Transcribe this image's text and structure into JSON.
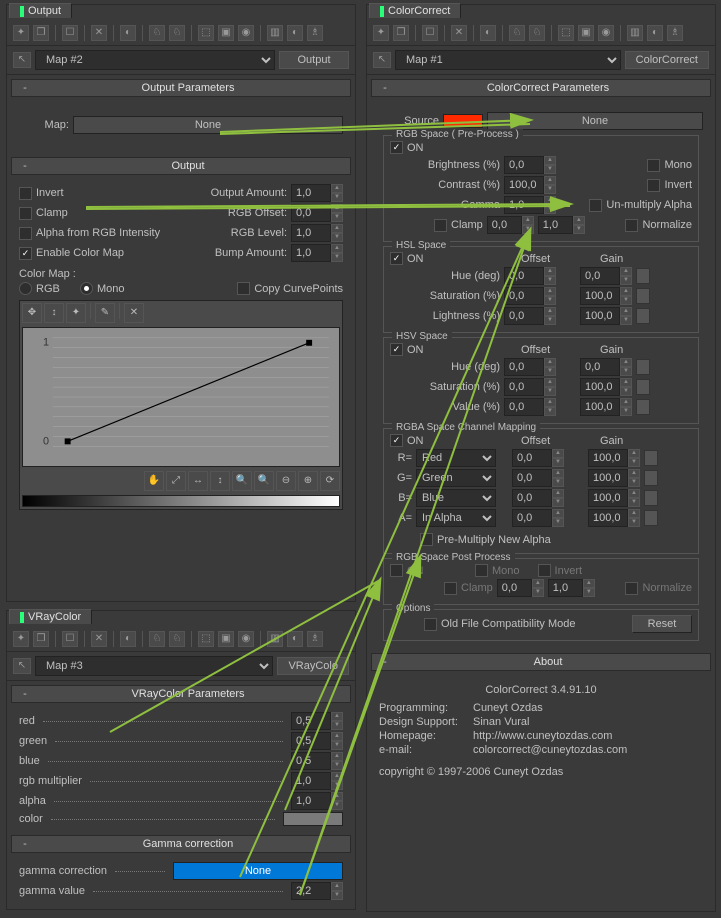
{
  "output_panel": {
    "tab_title": "Output",
    "map_select": "Map #2",
    "map_button": "Output",
    "params_section": "Output Parameters",
    "map_label": "Map:",
    "map_slot": "None",
    "output_section": "Output",
    "invert": "Invert",
    "clamp": "Clamp",
    "alpha_from_rgb": "Alpha from RGB Intensity",
    "enable_color_map": "Enable Color Map",
    "output_amount": "Output Amount:",
    "output_amount_val": "1,0",
    "rgb_offset": "RGB Offset:",
    "rgb_offset_val": "0,0",
    "rgb_level": "RGB Level:",
    "rgb_level_val": "1,0",
    "bump_amount": "Bump Amount:",
    "bump_amount_val": "1,0",
    "color_map": "Color Map :",
    "rgb_radio": "RGB",
    "mono_radio": "Mono",
    "copy_curvepoints": "Copy CurvePoints"
  },
  "vray_panel": {
    "tab_title": "VRayColor",
    "map_select": "Map #3",
    "map_button": "VRayColo",
    "params_section": "VRayColor Parameters",
    "red": "red",
    "red_val": "0,5",
    "green": "green",
    "green_val": "0,5",
    "blue": "blue",
    "blue_val": "0,5",
    "rgb_mult": "rgb multiplier",
    "rgb_mult_val": "1,0",
    "alpha": "alpha",
    "alpha_val": "1,0",
    "color": "color",
    "gamma_section": "Gamma correction",
    "gamma_corr": "gamma correction",
    "gamma_corr_val": "None",
    "gamma_value": "gamma value",
    "gamma_value_val": "2,2"
  },
  "cc_panel": {
    "tab_title": "ColorCorrect",
    "map_select": "Map #1",
    "map_button": "ColorCorrect",
    "params_section": "ColorCorrect Parameters",
    "source": "Source",
    "source_slot": "None",
    "rgb_space_pre": "RGB Space ( Pre-Process )",
    "on": "ON",
    "brightness": "Brightness (%)",
    "brightness_val": "0,0",
    "contrast": "Contrast (%)",
    "contrast_val": "100,0",
    "gamma": "Gamma",
    "gamma_val": "1,0",
    "mono": "Mono",
    "invert": "Invert",
    "unmult_alpha": "Un-multiply Alpha",
    "clamp": "Clamp",
    "clamp_lo": "0,0",
    "clamp_hi": "1,0",
    "normalize": "Normalize",
    "hsl_space": "HSL Space",
    "hsv_space": "HSV Space",
    "offset_hdr": "Offset",
    "gain_hdr": "Gain",
    "hue": "Hue (deg)",
    "saturation": "Saturation (%)",
    "lightness": "Lightness (%)",
    "value": "Value (%)",
    "val_00": "0,0",
    "val_100": "100,0",
    "rgba_space": "RGBA Space Channel Mapping",
    "r_eq": "R=",
    "g_eq": "G=",
    "b_eq": "B=",
    "a_eq": "A=",
    "red_opt": "Red",
    "green_opt": "Green",
    "blue_opt": "Blue",
    "alpha_opt": "In Alpha",
    "premult": "Pre-Multiply New Alpha",
    "rgb_space_post": "RGB Space Post Process",
    "options": "Options",
    "old_file": "Old File Compatibility Mode",
    "reset": "Reset",
    "about_section": "About",
    "about_title": "ColorCorrect 3.4.91.10",
    "programming": "Programming:",
    "programming_val": "Cuneyt Ozdas",
    "design": "Design Support:",
    "design_val": "Sinan Vural",
    "homepage": "Homepage:",
    "homepage_val": "http://www.cuneytozdas.com",
    "email": "e-mail:",
    "email_val": "colorcorrect@cuneytozdas.com",
    "copyright": "copyright © 1997-2006 Cuneyt Ozdas"
  }
}
